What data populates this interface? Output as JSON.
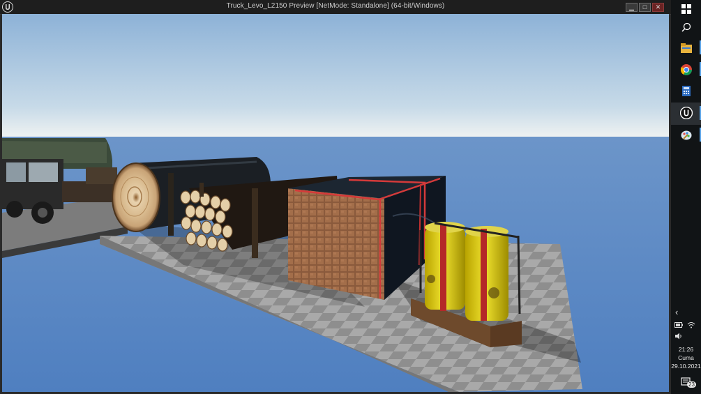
{
  "window": {
    "title": "Truck_Levo_L2150 Preview [NetMode: Standalone]  (64-bit/Windows)",
    "minimize_icon": "▁",
    "maximize_icon": "□",
    "close_icon": "✕"
  },
  "taskbar": {
    "time": "21:26",
    "day": "Cuma",
    "date": "29.10.2021",
    "notification_count": "23",
    "apps": [
      "windows-start",
      "search",
      "file-explorer",
      "chrome",
      "calculator",
      "unreal-engine",
      "paint"
    ]
  },
  "scene": {
    "sky_top": "#8fb3d8",
    "sky_horizon": "#e6eef2",
    "ground_color": "#5b86c4"
  }
}
